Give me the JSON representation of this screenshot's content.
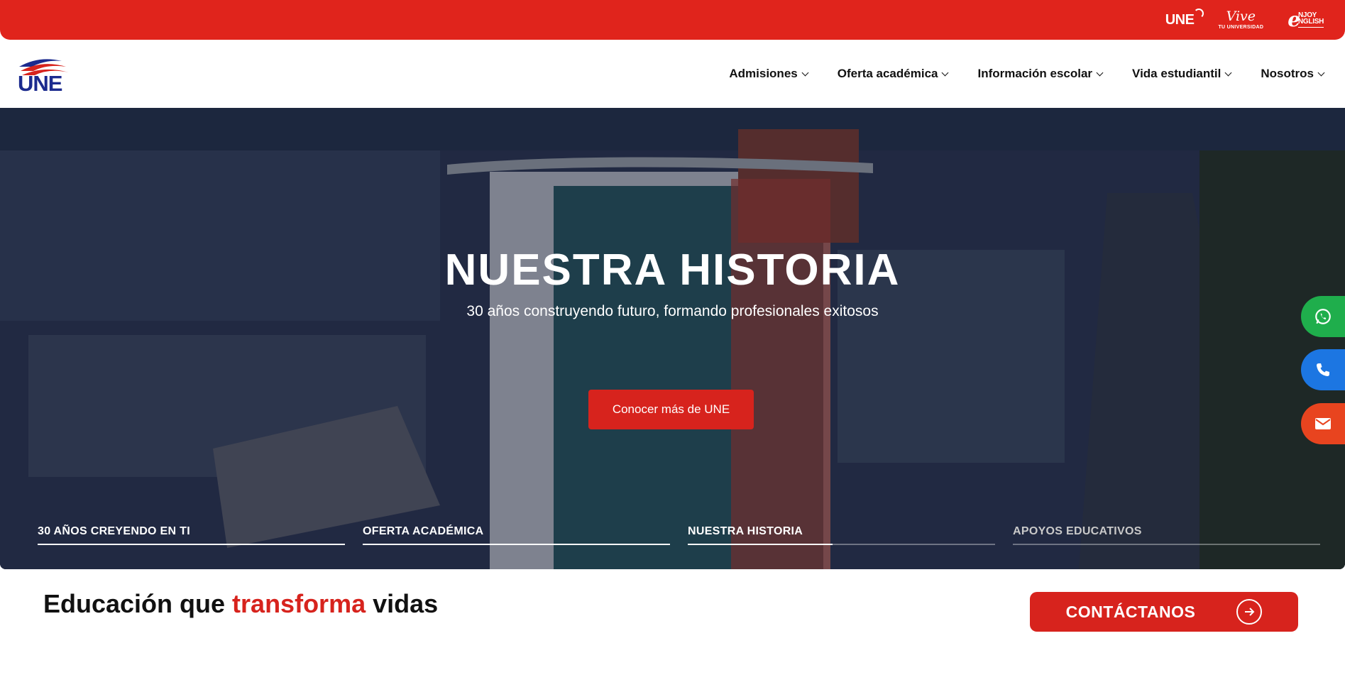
{
  "topbar": {
    "logos": [
      {
        "icon": "une-en-linea-logo",
        "text": "UNE"
      },
      {
        "icon": "vive-tu-universidad-logo",
        "script": "Vive",
        "caps": "TU UNIVERSIDAD"
      },
      {
        "icon": "enjoy-english-logo",
        "line1": "NJOY",
        "line2": "NGLISH"
      }
    ],
    "color": "#e0241c"
  },
  "header": {
    "logo_text": "UNE",
    "nav": [
      {
        "label": "Admisiones"
      },
      {
        "label": "Oferta académica"
      },
      {
        "label": "Información escolar"
      },
      {
        "label": "Vida estudiantil"
      },
      {
        "label": "Nosotros"
      }
    ]
  },
  "hero": {
    "title": "NUESTRA HISTORIA",
    "subtitle": "30 años construyendo futuro, formando profesionales exitosos",
    "button_label": "Conocer más de UNE",
    "slides": [
      {
        "label": "30 AÑOS CREYENDO EN TI",
        "progress": 1.0
      },
      {
        "label": "OFERTA ACADÉMICA",
        "progress": 1.0
      },
      {
        "label": "NUESTRA HISTORIA",
        "progress": 0.47
      },
      {
        "label": "APOYOS EDUCATIVOS",
        "progress": 0.0
      }
    ]
  },
  "floating": [
    {
      "icon": "whatsapp-icon",
      "color": "#1fae4c"
    },
    {
      "icon": "phone-icon",
      "color": "#1c76e2"
    },
    {
      "icon": "mail-icon",
      "color": "#e8441f"
    }
  ],
  "bottom": {
    "tagline_pre": "Educación que ",
    "tagline_accent": "transforma",
    "tagline_post": " vidas",
    "contact_label": "CONTÁCTANOS"
  },
  "colors": {
    "accent": "#d7231d",
    "brand_blue": "#1b2a8e"
  }
}
